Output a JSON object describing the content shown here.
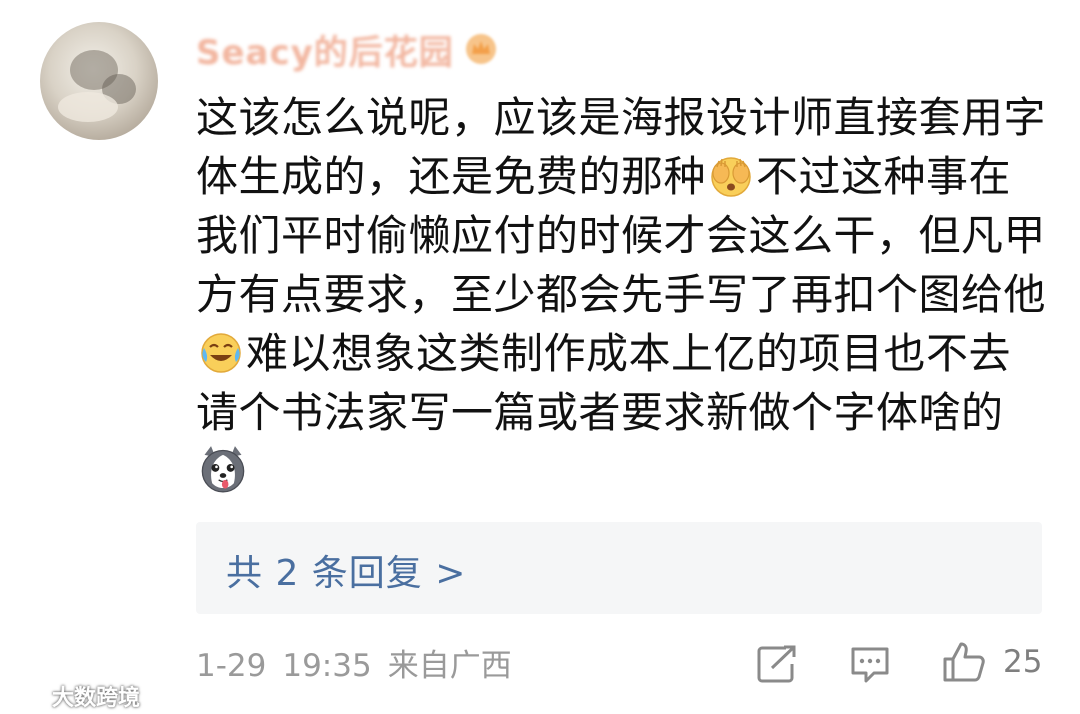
{
  "comment": {
    "username": "Seacy的后花园",
    "lines": [
      {
        "before": "这该怎么说呢，应该是海报设计师直接套用字",
        "after": ""
      },
      {
        "before": "体生成的，还是免费的那种",
        "after": "不过这种事在"
      },
      {
        "before": "我们平时偷懒应付的时候才会这么干，但凡甲",
        "after": ""
      },
      {
        "before": "方有点要求，至少都会先手写了再扣个图给他",
        "after": ""
      },
      {
        "before": "",
        "after": "难以想象这类制作成本上亿的项目也不去"
      },
      {
        "before": "请个书法家写一篇或者要求新做个字体啥的",
        "after": ""
      }
    ],
    "emojis": [
      "covering-face-emoji",
      "laugh-cry-emoji",
      "husky-dog-emoji"
    ]
  },
  "replies": {
    "label": "共 2 条回复 >"
  },
  "meta": {
    "date": "1-29",
    "time": "19:35",
    "location": "来自广西"
  },
  "actions": {
    "share_icon": "share-icon",
    "comment_icon": "comment-icon",
    "like_icon": "thumbs-up-icon",
    "like_count": "25"
  },
  "watermark": {
    "text": "大数跨境"
  },
  "colors": {
    "username": "#f2b6a0",
    "link": "#4a6fa0",
    "meta": "#9a9a9a",
    "reply_bg": "#f5f6f7"
  }
}
